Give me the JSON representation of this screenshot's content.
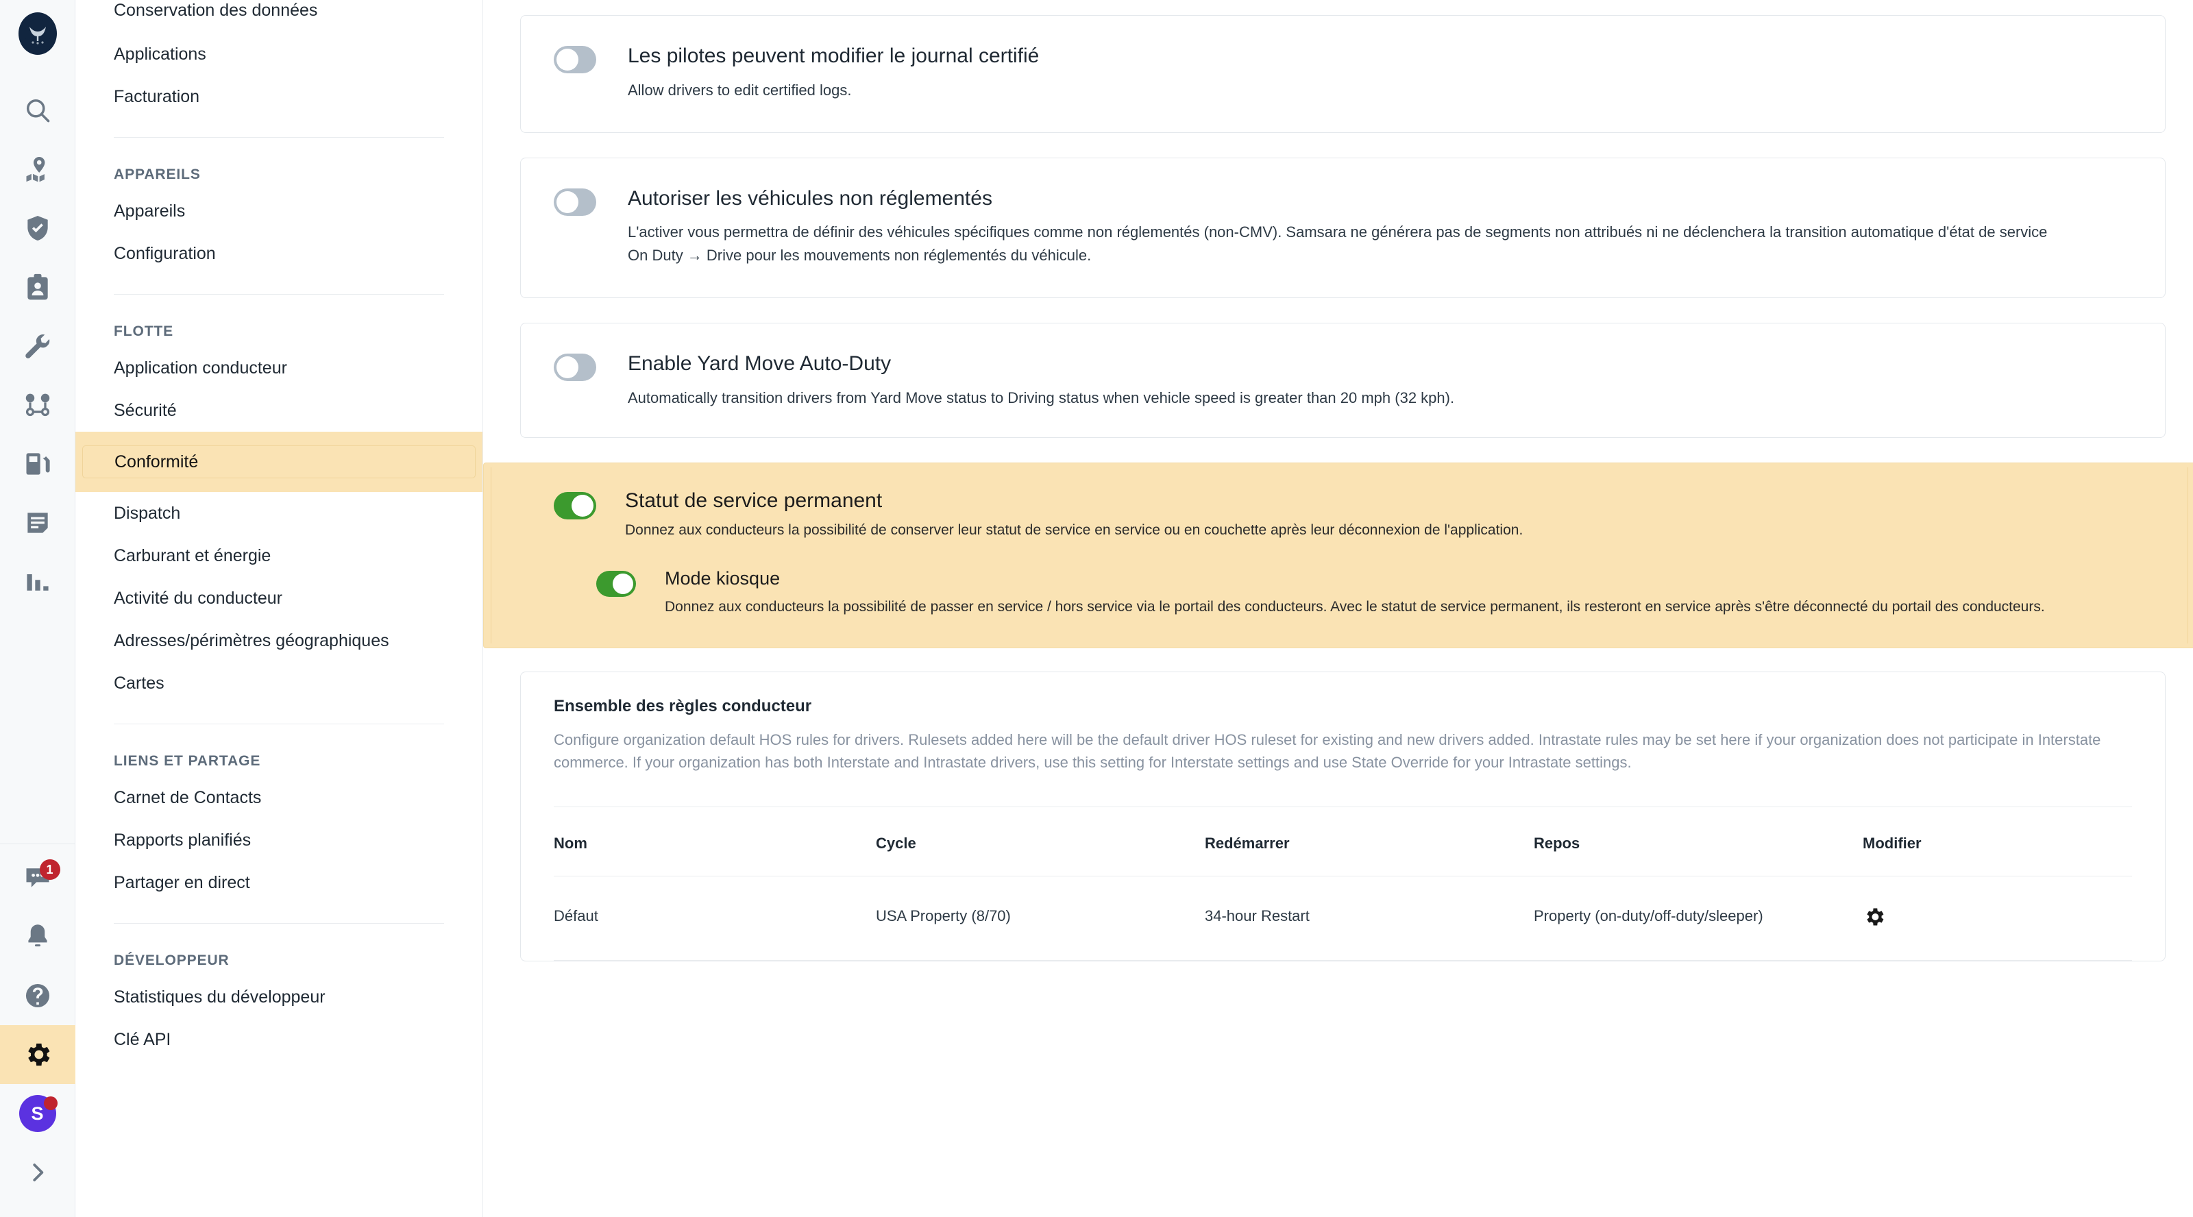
{
  "rail": {
    "logo_name": "samsara-logo",
    "icons": [
      {
        "name": "search-icon",
        "label": "Recherche"
      },
      {
        "name": "map-location-icon",
        "label": "Carte"
      },
      {
        "name": "shield-check-icon",
        "label": "Sécurité"
      },
      {
        "name": "id-badge-icon",
        "label": "Conducteurs"
      },
      {
        "name": "wrench-icon",
        "label": "Maintenance"
      },
      {
        "name": "routes-icon",
        "label": "Itinéraires"
      },
      {
        "name": "fuel-pump-icon",
        "label": "Carburant"
      },
      {
        "name": "document-icon",
        "label": "Documents"
      },
      {
        "name": "bar-chart-icon",
        "label": "Rapports"
      }
    ],
    "bottom_icons": [
      {
        "name": "chat-icon",
        "label": "Messages",
        "badge": "1"
      },
      {
        "name": "bell-icon",
        "label": "Notifications",
        "badge": ""
      },
      {
        "name": "help-circle-icon",
        "label": "Aide",
        "badge": ""
      },
      {
        "name": "gear-icon",
        "label": "Paramètres",
        "badge": "",
        "active": true
      }
    ],
    "avatar_initial": "S",
    "expand_label": "Développer"
  },
  "sidebar": {
    "groups": [
      {
        "heading": "",
        "items": [
          {
            "label": "Conservation des données",
            "clipped": true
          },
          {
            "label": "Applications"
          },
          {
            "label": "Facturation"
          }
        ]
      },
      {
        "heading": "APPAREILS",
        "items": [
          {
            "label": "Appareils"
          },
          {
            "label": "Configuration"
          }
        ]
      },
      {
        "heading": "FLOTTE",
        "items": [
          {
            "label": "Application conducteur"
          },
          {
            "label": "Sécurité"
          },
          {
            "label": "Conformité",
            "active": true
          },
          {
            "label": "Dispatch"
          },
          {
            "label": "Carburant et énergie"
          },
          {
            "label": "Activité du conducteur"
          },
          {
            "label": "Adresses/périmètres géographiques"
          },
          {
            "label": "Cartes"
          }
        ]
      },
      {
        "heading": "LIENS ET PARTAGE",
        "items": [
          {
            "label": "Carnet de Contacts"
          },
          {
            "label": "Rapports planifiés"
          },
          {
            "label": "Partager en direct"
          }
        ]
      },
      {
        "heading": "DÉVELOPPEUR",
        "items": [
          {
            "label": "Statistiques du développeur"
          },
          {
            "label": "Clé API",
            "clipped_bottom": true
          }
        ]
      }
    ]
  },
  "settings": {
    "cards": [
      {
        "title": "Les pilotes peuvent modifier le journal certifié",
        "desc": "Allow drivers to edit certified logs.",
        "toggle_on": false
      },
      {
        "title": "Autoriser les véhicules non réglementés",
        "desc": "L'activer vous permettra de définir des véhicules spécifiques comme non réglementés (non-CMV). Samsara ne générera pas de segments non attribués ni ne déclenchera la transition automatique d'état de service On Duty → Drive pour les mouvements non réglementés du véhicule.",
        "toggle_on": false
      },
      {
        "title": "Enable Yard Move Auto-Duty",
        "desc": "Automatically transition drivers from Yard Move status to Driving status when vehicle speed is greater than 20 mph (32 kph).",
        "toggle_on": false
      }
    ],
    "highlighted": {
      "title": "Statut de service permanent",
      "desc": "Donnez aux conducteurs la possibilité de conserver leur statut de service en service ou en couchette après leur déconnexion de l'application.",
      "toggle_on": true,
      "sub": {
        "title": "Mode kiosque",
        "desc": "Donnez aux conducteurs la possibilité de passer en service / hors service via le portail des conducteurs. Avec le statut de service permanent, ils resteront en service après s'être déconnecté du portail des conducteurs.",
        "toggle_on": true
      }
    }
  },
  "ruleset": {
    "title": "Ensemble des règles conducteur",
    "description": "Configure organization default HOS rules for drivers. Rulesets added here will be the default driver HOS ruleset for existing and new drivers added. Intrastate rules may be set here if your organization does not participate in Interstate commerce. If your organization has both Interstate and Intrastate drivers, use this setting for Interstate settings and use State Override for your Intrastate settings.",
    "columns": [
      "Nom",
      "Cycle",
      "Redémarrer",
      "Repos",
      "Modifier"
    ],
    "rows": [
      {
        "nom": "Défaut",
        "cycle": "USA Property (8/70)",
        "redemarrer": "34-hour Restart",
        "repos": "Property (on-duty/off-duty/sleeper)",
        "modifier_icon": "gear-icon"
      }
    ]
  },
  "colors": {
    "highlight": "#fae3b4",
    "toggle_on": "#3c9a2e",
    "toggle_off": "#b4bfca",
    "badge_red": "#c0242e",
    "avatar_purple": "#5b32e0"
  }
}
